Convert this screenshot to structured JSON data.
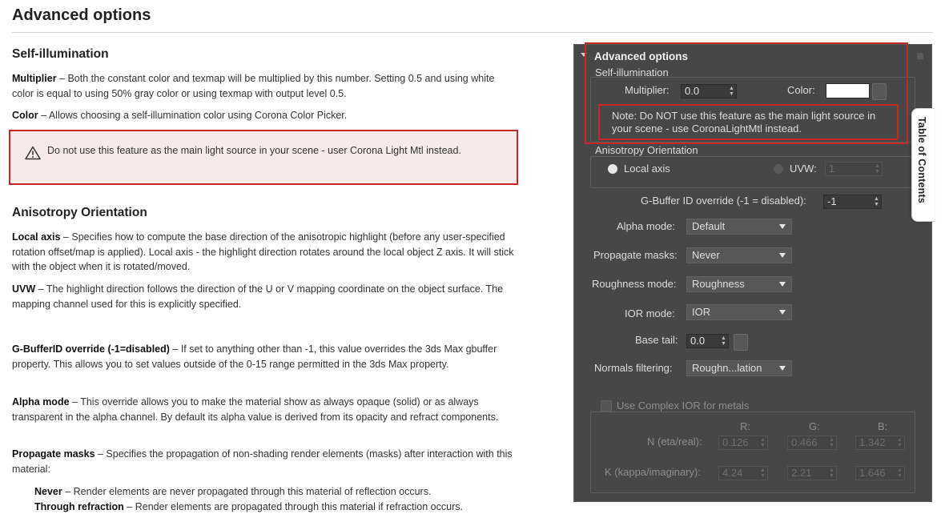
{
  "doc": {
    "title": "Advanced options",
    "self_illum": {
      "heading": "Self-illumination",
      "multiplier_term": "Multiplier",
      "multiplier_text": " – Both the constant color and texmap will be multiplied by this number. Setting 0.5 and using white color is equal to using 50% gray color or using texmap with output level 0.5.",
      "color_term": "Color",
      "color_text": " – Allows choosing a self-illumination color using Corona Color Picker.",
      "warning": "Do not use this feature as the main light source in your scene - user Corona Light Mtl instead."
    },
    "aniso": {
      "heading": "Anisotropy Orientation",
      "local_term": "Local axis",
      "local_text": " – Specifies how to compute the base direction of the anisotropic highlight (before any user-specified rotation offset/map is applied). Local axis - the highlight direction rotates around the local object Z axis. It will stick with the object when it is rotated/moved.",
      "uvw_term": "UVW",
      "uvw_text": " – The highlight direction follows the direction of the U or V mapping coordinate on the object surface. The mapping channel used for this is explicitly specified."
    },
    "gbuffer_term": "G-BufferID override (-1=disabled)",
    "gbuffer_text": " – If set to anything other than -1, this value overrides the 3ds Max gbuffer property. This allows you to set values outside of the 0-15 range permitted in the 3ds Max property.",
    "alpha_term": "Alpha mode",
    "alpha_text": " – This override allows you to make the material show as always opaque (solid) or as always transparent in the alpha channel. By default its alpha value is derived from its opacity and refract components.",
    "propagate_term": "Propagate masks",
    "propagate_text": " – Specifies the propagation of non-shading render elements (masks) after interaction with this material:",
    "never_term": "Never",
    "never_text": " – Render elements are never propagated through this material of reflection occurs.",
    "through_term": "Through refraction",
    "through_text": " – Render elements are propagated through this material if refraction occurs."
  },
  "panel": {
    "title": "Advanced options",
    "self_illum_group": "Self-illumination",
    "multiplier_label": "Multiplier:",
    "multiplier_value": "0.0",
    "color_label": "Color:",
    "color_swatch": "#ffffff",
    "note": "Note: Do NOT use this feature as the main light source in your scene - use CoronaLightMtl instead.",
    "aniso_group": "Anisotropy Orientation",
    "local_axis": "Local axis",
    "uvw_label": "UVW:",
    "uvw_value": "1",
    "gbuffer_label": "G-Buffer ID override (-1 = disabled):",
    "gbuffer_value": "-1",
    "alpha_label": "Alpha mode:",
    "alpha_value": "Default",
    "propagate_label": "Propagate masks:",
    "propagate_value": "Never",
    "roughness_label": "Roughness mode:",
    "roughness_value": "Roughness",
    "ior_label": "IOR mode:",
    "ior_value": "IOR",
    "base_tail_label": "Base tail:",
    "base_tail_value": "0.0",
    "normals_label": "Normals filtering:",
    "normals_value": "Roughn...lation",
    "complex_ior": "Use Complex IOR for metals",
    "col_r": "R:",
    "col_g": "G:",
    "col_b": "B:",
    "n_label": "N (eta/real):",
    "n_r": "0.126",
    "n_g": "0.466",
    "n_b": "1.342",
    "k_label": "K (kappa/imaginary):",
    "k_r": "4.24",
    "k_g": "2.21",
    "k_b": "1.646"
  },
  "toc": {
    "label": "Table of Contents"
  },
  "colors": {
    "highlight_red": "#c62828",
    "panel_bg": "#474747",
    "warning_bg": "#f7eaea"
  }
}
